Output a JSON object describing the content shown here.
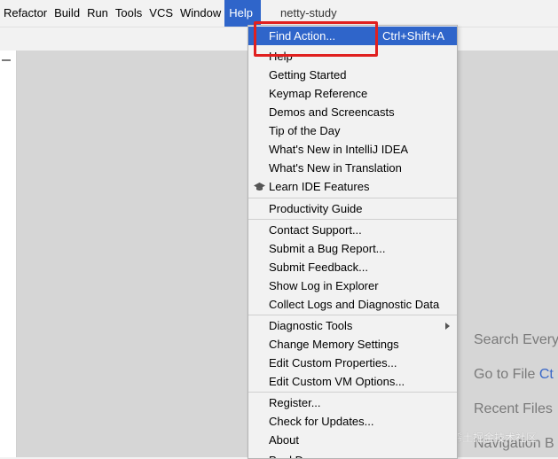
{
  "menubar": {
    "items": [
      {
        "label": "Refactor"
      },
      {
        "label": "Build"
      },
      {
        "label": "Run"
      },
      {
        "label": "Tools"
      },
      {
        "label": "VCS"
      },
      {
        "label": "Window"
      },
      {
        "label": "Help",
        "active": true
      }
    ],
    "project_name": "netty-study"
  },
  "help_menu": {
    "items": [
      {
        "label": "Find Action...",
        "shortcut": "Ctrl+Shift+A",
        "highlighted": true
      },
      {
        "label": "Help"
      },
      {
        "label": "Getting Started"
      },
      {
        "label": "Keymap Reference"
      },
      {
        "label": "Demos and Screencasts"
      },
      {
        "label": "Tip of the Day"
      },
      {
        "label": "What's New in IntelliJ IDEA"
      },
      {
        "label": "What's New in Translation"
      },
      {
        "label": "Learn IDE Features",
        "icon": "graduation-cap-icon"
      },
      {
        "label": "Productivity Guide"
      },
      {
        "label": "Contact Support..."
      },
      {
        "label": "Submit a Bug Report..."
      },
      {
        "label": "Submit Feedback..."
      },
      {
        "label": "Show Log in Explorer"
      },
      {
        "label": "Collect Logs and Diagnostic Data"
      },
      {
        "label": "Diagnostic Tools",
        "submenu": true
      },
      {
        "label": "Change Memory Settings"
      },
      {
        "label": "Edit Custom Properties..."
      },
      {
        "label": "Edit Custom VM Options..."
      },
      {
        "label": "Register..."
      },
      {
        "label": "Check for Updates..."
      },
      {
        "label": "About"
      },
      {
        "label": "Paul D..."
      }
    ]
  },
  "editor_hints": {
    "search_everywhere": "Search Every",
    "go_to_file": "Go to File",
    "go_to_file_shortcut": "Ct",
    "recent_files": "Recent Files",
    "navigation_bar": "Navigation B"
  },
  "watermark": "@稀土掘金技术社区",
  "colors": {
    "highlight": "#2f65ca",
    "annotation_red": "#e0201f",
    "menu_bg": "#f2f2f2",
    "editor_bg": "#d6d6d6"
  }
}
